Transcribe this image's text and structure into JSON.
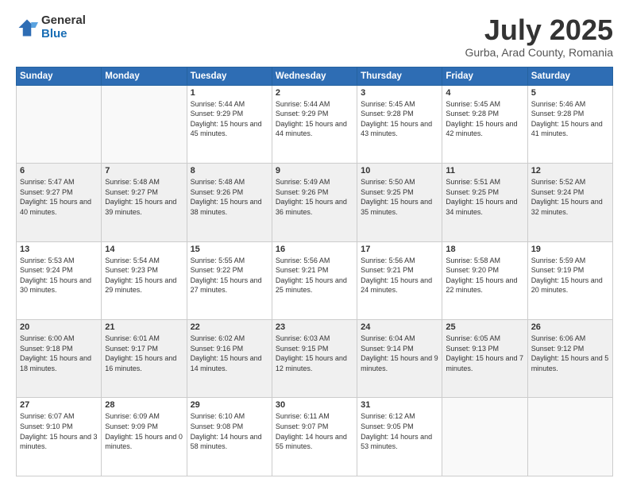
{
  "logo": {
    "general": "General",
    "blue": "Blue"
  },
  "title": "July 2025",
  "location": "Gurba, Arad County, Romania",
  "days_header": [
    "Sunday",
    "Monday",
    "Tuesday",
    "Wednesday",
    "Thursday",
    "Friday",
    "Saturday"
  ],
  "weeks": [
    [
      {
        "day": "",
        "sunrise": "",
        "sunset": "",
        "daylight": ""
      },
      {
        "day": "",
        "sunrise": "",
        "sunset": "",
        "daylight": ""
      },
      {
        "day": "1",
        "sunrise": "Sunrise: 5:44 AM",
        "sunset": "Sunset: 9:29 PM",
        "daylight": "Daylight: 15 hours and 45 minutes."
      },
      {
        "day": "2",
        "sunrise": "Sunrise: 5:44 AM",
        "sunset": "Sunset: 9:29 PM",
        "daylight": "Daylight: 15 hours and 44 minutes."
      },
      {
        "day": "3",
        "sunrise": "Sunrise: 5:45 AM",
        "sunset": "Sunset: 9:28 PM",
        "daylight": "Daylight: 15 hours and 43 minutes."
      },
      {
        "day": "4",
        "sunrise": "Sunrise: 5:45 AM",
        "sunset": "Sunset: 9:28 PM",
        "daylight": "Daylight: 15 hours and 42 minutes."
      },
      {
        "day": "5",
        "sunrise": "Sunrise: 5:46 AM",
        "sunset": "Sunset: 9:28 PM",
        "daylight": "Daylight: 15 hours and 41 minutes."
      }
    ],
    [
      {
        "day": "6",
        "sunrise": "Sunrise: 5:47 AM",
        "sunset": "Sunset: 9:27 PM",
        "daylight": "Daylight: 15 hours and 40 minutes."
      },
      {
        "day": "7",
        "sunrise": "Sunrise: 5:48 AM",
        "sunset": "Sunset: 9:27 PM",
        "daylight": "Daylight: 15 hours and 39 minutes."
      },
      {
        "day": "8",
        "sunrise": "Sunrise: 5:48 AM",
        "sunset": "Sunset: 9:26 PM",
        "daylight": "Daylight: 15 hours and 38 minutes."
      },
      {
        "day": "9",
        "sunrise": "Sunrise: 5:49 AM",
        "sunset": "Sunset: 9:26 PM",
        "daylight": "Daylight: 15 hours and 36 minutes."
      },
      {
        "day": "10",
        "sunrise": "Sunrise: 5:50 AM",
        "sunset": "Sunset: 9:25 PM",
        "daylight": "Daylight: 15 hours and 35 minutes."
      },
      {
        "day": "11",
        "sunrise": "Sunrise: 5:51 AM",
        "sunset": "Sunset: 9:25 PM",
        "daylight": "Daylight: 15 hours and 34 minutes."
      },
      {
        "day": "12",
        "sunrise": "Sunrise: 5:52 AM",
        "sunset": "Sunset: 9:24 PM",
        "daylight": "Daylight: 15 hours and 32 minutes."
      }
    ],
    [
      {
        "day": "13",
        "sunrise": "Sunrise: 5:53 AM",
        "sunset": "Sunset: 9:24 PM",
        "daylight": "Daylight: 15 hours and 30 minutes."
      },
      {
        "day": "14",
        "sunrise": "Sunrise: 5:54 AM",
        "sunset": "Sunset: 9:23 PM",
        "daylight": "Daylight: 15 hours and 29 minutes."
      },
      {
        "day": "15",
        "sunrise": "Sunrise: 5:55 AM",
        "sunset": "Sunset: 9:22 PM",
        "daylight": "Daylight: 15 hours and 27 minutes."
      },
      {
        "day": "16",
        "sunrise": "Sunrise: 5:56 AM",
        "sunset": "Sunset: 9:21 PM",
        "daylight": "Daylight: 15 hours and 25 minutes."
      },
      {
        "day": "17",
        "sunrise": "Sunrise: 5:56 AM",
        "sunset": "Sunset: 9:21 PM",
        "daylight": "Daylight: 15 hours and 24 minutes."
      },
      {
        "day": "18",
        "sunrise": "Sunrise: 5:58 AM",
        "sunset": "Sunset: 9:20 PM",
        "daylight": "Daylight: 15 hours and 22 minutes."
      },
      {
        "day": "19",
        "sunrise": "Sunrise: 5:59 AM",
        "sunset": "Sunset: 9:19 PM",
        "daylight": "Daylight: 15 hours and 20 minutes."
      }
    ],
    [
      {
        "day": "20",
        "sunrise": "Sunrise: 6:00 AM",
        "sunset": "Sunset: 9:18 PM",
        "daylight": "Daylight: 15 hours and 18 minutes."
      },
      {
        "day": "21",
        "sunrise": "Sunrise: 6:01 AM",
        "sunset": "Sunset: 9:17 PM",
        "daylight": "Daylight: 15 hours and 16 minutes."
      },
      {
        "day": "22",
        "sunrise": "Sunrise: 6:02 AM",
        "sunset": "Sunset: 9:16 PM",
        "daylight": "Daylight: 15 hours and 14 minutes."
      },
      {
        "day": "23",
        "sunrise": "Sunrise: 6:03 AM",
        "sunset": "Sunset: 9:15 PM",
        "daylight": "Daylight: 15 hours and 12 minutes."
      },
      {
        "day": "24",
        "sunrise": "Sunrise: 6:04 AM",
        "sunset": "Sunset: 9:14 PM",
        "daylight": "Daylight: 15 hours and 9 minutes."
      },
      {
        "day": "25",
        "sunrise": "Sunrise: 6:05 AM",
        "sunset": "Sunset: 9:13 PM",
        "daylight": "Daylight: 15 hours and 7 minutes."
      },
      {
        "day": "26",
        "sunrise": "Sunrise: 6:06 AM",
        "sunset": "Sunset: 9:12 PM",
        "daylight": "Daylight: 15 hours and 5 minutes."
      }
    ],
    [
      {
        "day": "27",
        "sunrise": "Sunrise: 6:07 AM",
        "sunset": "Sunset: 9:10 PM",
        "daylight": "Daylight: 15 hours and 3 minutes."
      },
      {
        "day": "28",
        "sunrise": "Sunrise: 6:09 AM",
        "sunset": "Sunset: 9:09 PM",
        "daylight": "Daylight: 15 hours and 0 minutes."
      },
      {
        "day": "29",
        "sunrise": "Sunrise: 6:10 AM",
        "sunset": "Sunset: 9:08 PM",
        "daylight": "Daylight: 14 hours and 58 minutes."
      },
      {
        "day": "30",
        "sunrise": "Sunrise: 6:11 AM",
        "sunset": "Sunset: 9:07 PM",
        "daylight": "Daylight: 14 hours and 55 minutes."
      },
      {
        "day": "31",
        "sunrise": "Sunrise: 6:12 AM",
        "sunset": "Sunset: 9:05 PM",
        "daylight": "Daylight: 14 hours and 53 minutes."
      },
      {
        "day": "",
        "sunrise": "",
        "sunset": "",
        "daylight": ""
      },
      {
        "day": "",
        "sunrise": "",
        "sunset": "",
        "daylight": ""
      }
    ]
  ]
}
